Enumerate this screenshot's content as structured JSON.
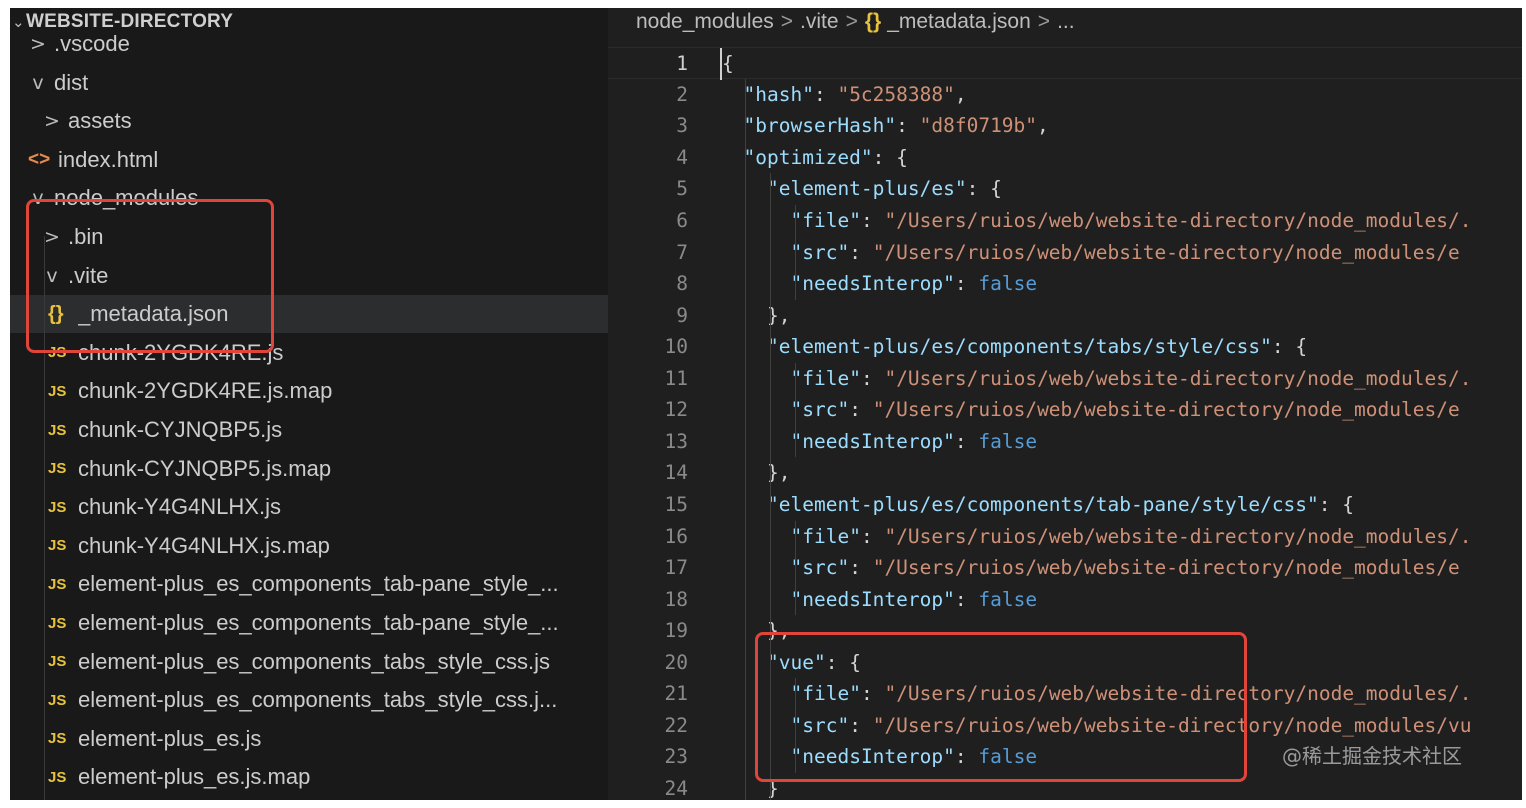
{
  "explorer": {
    "title": "WEBSITE-DIRECTORY",
    "items": [
      {
        "label": ".vscode",
        "type": "folder",
        "expanded": false
      },
      {
        "label": "dist",
        "type": "folder",
        "expanded": true
      },
      {
        "label": "assets",
        "type": "folder",
        "expanded": false
      },
      {
        "label": "index.html",
        "type": "file",
        "icon": "html-icon"
      },
      {
        "label": "node_modules",
        "type": "folder",
        "expanded": true
      },
      {
        "label": ".bin",
        "type": "folder",
        "expanded": false
      },
      {
        "label": ".vite",
        "type": "folder",
        "expanded": true
      },
      {
        "label": "_metadata.json",
        "type": "file",
        "icon": "json-icon",
        "selected": true
      },
      {
        "label": "chunk-2YGDK4RE.js",
        "type": "file",
        "icon": "js-icon"
      },
      {
        "label": "chunk-2YGDK4RE.js.map",
        "type": "file",
        "icon": "js-icon"
      },
      {
        "label": "chunk-CYJNQBP5.js",
        "type": "file",
        "icon": "js-icon"
      },
      {
        "label": "chunk-CYJNQBP5.js.map",
        "type": "file",
        "icon": "js-icon"
      },
      {
        "label": "chunk-Y4G4NLHX.js",
        "type": "file",
        "icon": "js-icon"
      },
      {
        "label": "chunk-Y4G4NLHX.js.map",
        "type": "file",
        "icon": "js-icon"
      },
      {
        "label": "element-plus_es_components_tab-pane_style_...",
        "type": "file",
        "icon": "js-icon"
      },
      {
        "label": "element-plus_es_components_tab-pane_style_...",
        "type": "file",
        "icon": "js-icon"
      },
      {
        "label": "element-plus_es_components_tabs_style_css.js",
        "type": "file",
        "icon": "js-icon"
      },
      {
        "label": "element-plus_es_components_tabs_style_css.j...",
        "type": "file",
        "icon": "js-icon"
      },
      {
        "label": "element-plus_es.js",
        "type": "file",
        "icon": "js-icon"
      },
      {
        "label": "element-plus_es.js.map",
        "type": "file",
        "icon": "js-icon"
      }
    ],
    "icons": {
      "html": "<>",
      "json": "{}",
      "js": "JS",
      "collapsed": ">",
      "expanded": "v"
    }
  },
  "breadcrumb": {
    "parts": [
      "node_modules",
      ".vite",
      "_metadata.json",
      "..."
    ],
    "separator": ">",
    "json_icon": "{}"
  },
  "editor": {
    "line_numbers": [
      "1",
      "2",
      "3",
      "4",
      "5",
      "6",
      "7",
      "8",
      "9",
      "10",
      "11",
      "12",
      "13",
      "14",
      "15",
      "16",
      "17",
      "18",
      "19",
      "20",
      "21",
      "22",
      "23",
      "24"
    ],
    "lines": [
      "{",
      "  \"hash\": \"5c258388\",",
      "  \"browserHash\": \"d8f0719b\",",
      "  \"optimized\": {",
      "    \"element-plus/es\": {",
      "      \"file\": \"/Users/ruios/web/website-directory/node_modules/.",
      "      \"src\": \"/Users/ruios/web/website-directory/node_modules/e",
      "      \"needsInterop\": false",
      "    },",
      "    \"element-plus/es/components/tabs/style/css\": {",
      "      \"file\": \"/Users/ruios/web/website-directory/node_modules/.",
      "      \"src\": \"/Users/ruios/web/website-directory/node_modules/e",
      "      \"needsInterop\": false",
      "    },",
      "    \"element-plus/es/components/tab-pane/style/css\": {",
      "      \"file\": \"/Users/ruios/web/website-directory/node_modules/.",
      "      \"src\": \"/Users/ruios/web/website-directory/node_modules/e",
      "      \"needsInterop\": false",
      "    },",
      "    \"vue\": {",
      "      \"file\": \"/Users/ruios/web/website-directory/node_modules/.",
      "      \"src\": \"/Users/ruios/web/website-directory/node_modules/vu",
      "      \"needsInterop\": false",
      "    }"
    ]
  },
  "watermark": "@稀土掘金技术社区",
  "colors": {
    "background": "#1f1f1f",
    "sidebar": "#191919",
    "highlight": "#e0453a",
    "json_key": "#9cdcfe",
    "json_string": "#ce9178",
    "json_boolean": "#569cd6",
    "file_icon_js": "#e9c23d"
  }
}
